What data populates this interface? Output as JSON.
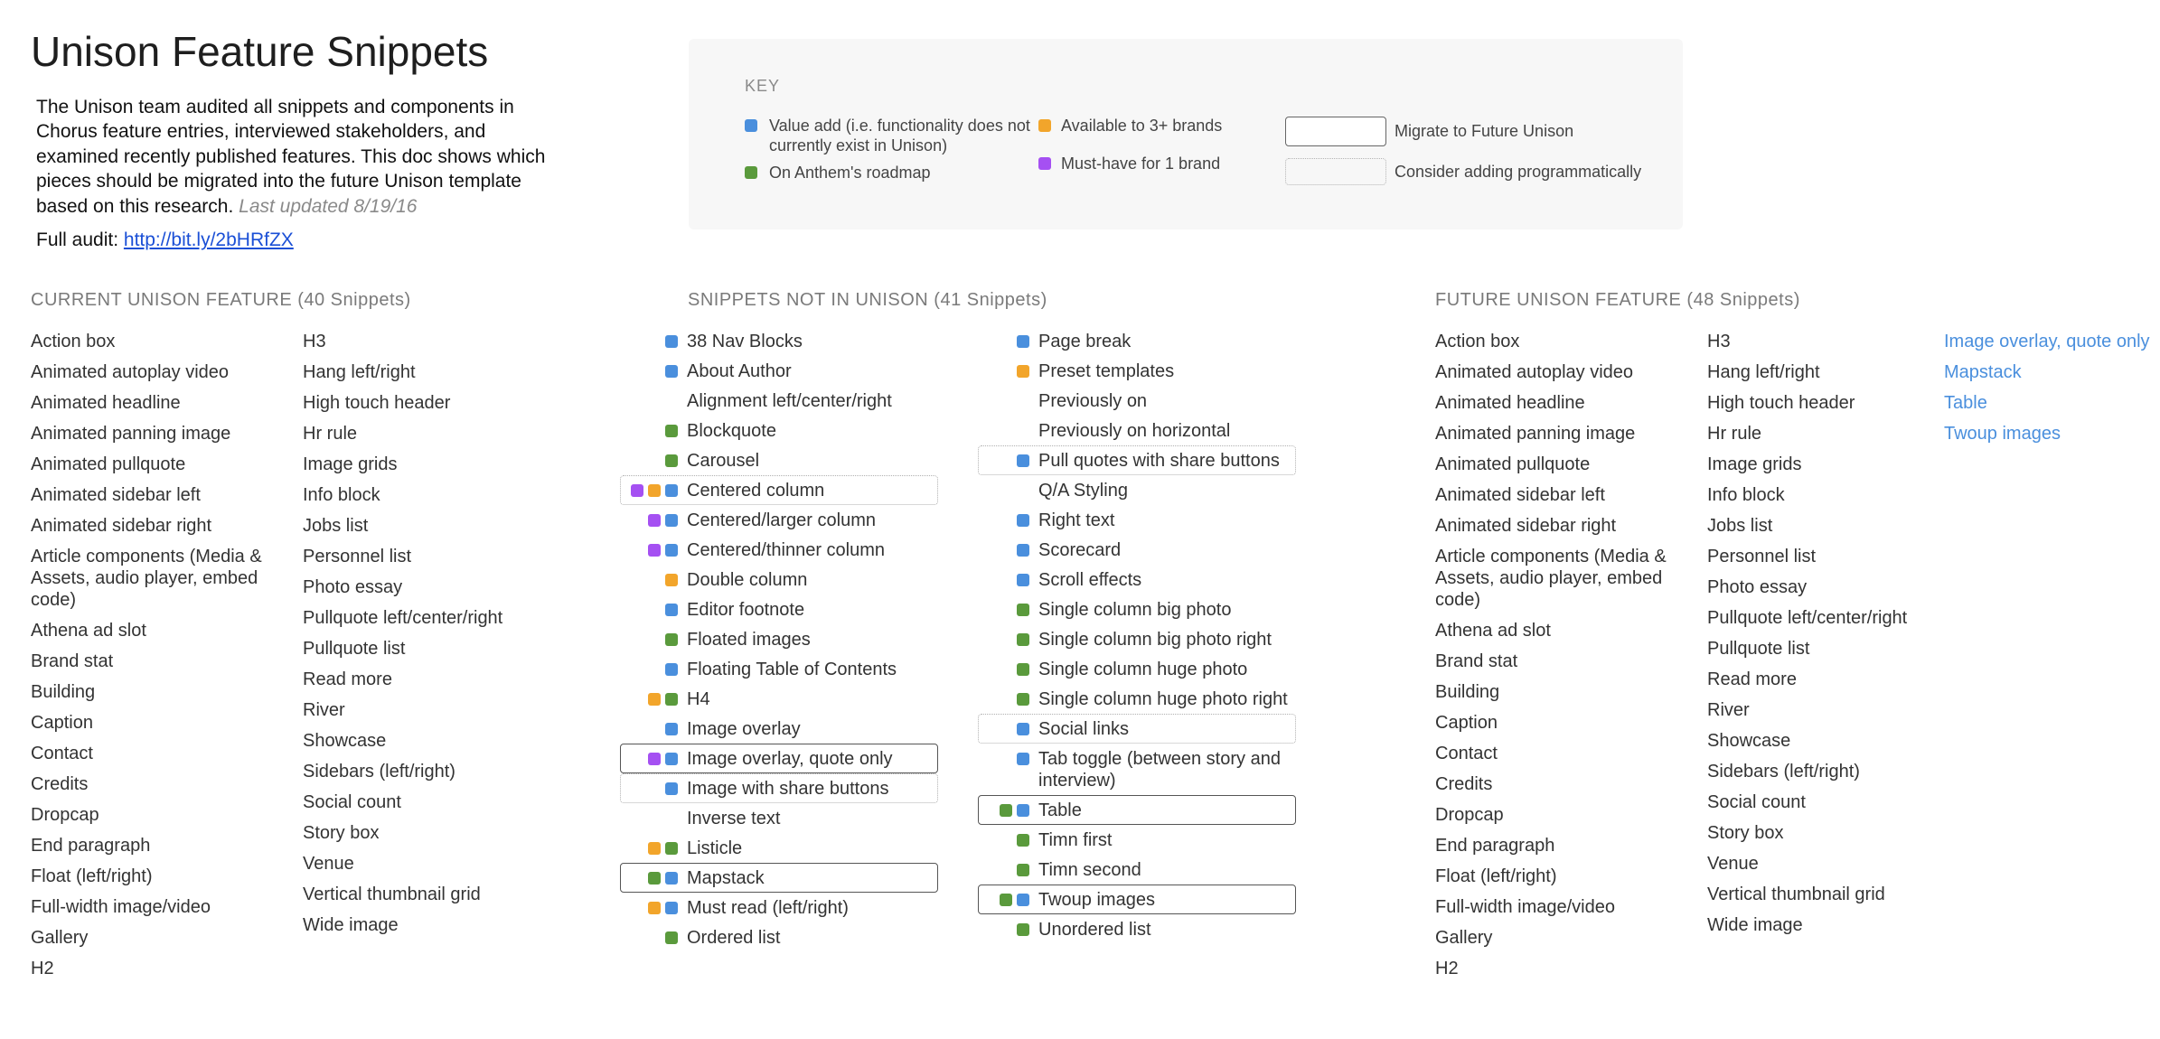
{
  "title": "Unison Feature Snippets",
  "intro": {
    "text": "The Unison team audited all snippets and components in\nChorus feature entries, interviewed stakeholders, and\nexamined recently published features. This doc shows which\npieces should be migrated into the future Unison template\nbased on this research.",
    "updated": "Last updated 8/19/16"
  },
  "audit": {
    "label": "Full audit:",
    "link_text": "http://bit.ly/2bHRfZX"
  },
  "colors": {
    "link": "#1a4fd6",
    "added_item": "#4a8fdd"
  },
  "key": {
    "heading": "KEY",
    "tags": [
      {
        "id": "value-add",
        "color": "#4a8fdd",
        "label": "Value add (i.e. functionality does not currently exist in Unison)"
      },
      {
        "id": "roadmap",
        "color": "#5a9a3c",
        "label": "On Anthem's roadmap"
      },
      {
        "id": "brands",
        "color": "#f2a52b",
        "label": "Available to 3+ brands"
      },
      {
        "id": "must-have",
        "color": "#a550f2",
        "label": "Must-have for 1 brand"
      }
    ],
    "boxes": [
      {
        "id": "migrate",
        "label": "Migrate to Future Unison"
      },
      {
        "id": "consider",
        "label": "Consider adding programmatically"
      }
    ]
  },
  "current": {
    "heading": "CURRENT UNISON FEATURE (40 Snippets)",
    "columns": [
      [
        "Action box",
        "Animated autoplay video",
        "Animated headline",
        "Animated panning image",
        "Animated pullquote",
        "Animated sidebar left",
        "Animated sidebar right",
        "Article components (Media & Assets, audio player, embed code)",
        "Athena ad slot",
        "Brand stat",
        "Building",
        "Caption",
        "Contact",
        "Credits",
        "Dropcap",
        "End paragraph",
        "Float (left/right)",
        "Full-width image/video",
        "Gallery",
        "H2"
      ],
      [
        "H3",
        "Hang left/right",
        "High touch header",
        "Hr rule",
        "Image grids",
        "Info block",
        "Jobs list",
        "Personnel list",
        "Photo essay",
        "Pullquote left/center/right",
        "Pullquote list",
        "Read more",
        "River",
        "Showcase",
        "Sidebars (left/right)",
        "Social count",
        "Story box",
        "Venue",
        "Vertical thumbnail grid",
        "Wide image"
      ]
    ]
  },
  "snippets": {
    "heading": "SNIPPETS NOT IN UNISON (41 Snippets)",
    "columns": [
      [
        {
          "label": "38 Nav Blocks",
          "tags": [
            "value-add"
          ]
        },
        {
          "label": "About Author",
          "tags": [
            "value-add"
          ]
        },
        {
          "label": "Alignment left/center/right",
          "tags": []
        },
        {
          "label": "Blockquote",
          "tags": [
            "roadmap"
          ]
        },
        {
          "label": "Carousel",
          "tags": [
            "roadmap"
          ]
        },
        {
          "label": "Centered column",
          "tags": [
            "must-have",
            "brands",
            "value-add"
          ],
          "box": "consider"
        },
        {
          "label": "Centered/larger column",
          "tags": [
            "must-have",
            "value-add"
          ]
        },
        {
          "label": "Centered/thinner column",
          "tags": [
            "must-have",
            "value-add"
          ]
        },
        {
          "label": "Double column",
          "tags": [
            "brands"
          ]
        },
        {
          "label": "Editor footnote",
          "tags": [
            "value-add"
          ]
        },
        {
          "label": "Floated images",
          "tags": [
            "roadmap"
          ]
        },
        {
          "label": "Floating Table of Contents",
          "tags": [
            "value-add"
          ]
        },
        {
          "label": "H4",
          "tags": [
            "brands",
            "roadmap"
          ]
        },
        {
          "label": "Image overlay",
          "tags": [
            "value-add"
          ]
        },
        {
          "label": "Image overlay, quote only",
          "tags": [
            "must-have",
            "value-add"
          ],
          "box": "migrate"
        },
        {
          "label": "Image with share buttons",
          "tags": [
            "value-add"
          ],
          "box": "consider"
        },
        {
          "label": "Inverse text",
          "tags": []
        },
        {
          "label": "Listicle",
          "tags": [
            "brands",
            "roadmap"
          ]
        },
        {
          "label": "Mapstack",
          "tags": [
            "roadmap",
            "value-add"
          ],
          "box": "migrate"
        },
        {
          "label": "Must read (left/right)",
          "tags": [
            "brands",
            "value-add"
          ]
        },
        {
          "label": "Ordered list",
          "tags": [
            "roadmap"
          ]
        }
      ],
      [
        {
          "label": "Page break",
          "tags": [
            "value-add"
          ]
        },
        {
          "label": "Preset templates",
          "tags": [
            "brands"
          ]
        },
        {
          "label": "Previously on",
          "tags": []
        },
        {
          "label": "Previously on horizontal",
          "tags": []
        },
        {
          "label": "Pull quotes with share buttons",
          "tags": [
            "value-add"
          ],
          "box": "consider"
        },
        {
          "label": "Q/A Styling",
          "tags": []
        },
        {
          "label": "Right text",
          "tags": [
            "value-add"
          ]
        },
        {
          "label": "Scorecard",
          "tags": [
            "value-add"
          ]
        },
        {
          "label": "Scroll effects",
          "tags": [
            "value-add"
          ]
        },
        {
          "label": "Single column big photo",
          "tags": [
            "roadmap"
          ]
        },
        {
          "label": "Single column big photo right",
          "tags": [
            "roadmap"
          ]
        },
        {
          "label": "Single column huge photo",
          "tags": [
            "roadmap"
          ]
        },
        {
          "label": "Single column huge photo right",
          "tags": [
            "roadmap"
          ]
        },
        {
          "label": "Social links",
          "tags": [
            "value-add"
          ],
          "box": "consider"
        },
        {
          "label": "Tab toggle (between story and interview)",
          "tags": [
            "value-add"
          ]
        },
        {
          "label": "Table",
          "tags": [
            "roadmap",
            "value-add"
          ],
          "box": "migrate"
        },
        {
          "label": "Timn first",
          "tags": [
            "roadmap"
          ]
        },
        {
          "label": "Timn second",
          "tags": [
            "roadmap"
          ]
        },
        {
          "label": "Twoup images",
          "tags": [
            "roadmap",
            "value-add"
          ],
          "box": "migrate"
        },
        {
          "label": "Unordered list",
          "tags": [
            "roadmap"
          ]
        }
      ]
    ]
  },
  "future": {
    "heading": "FUTURE UNISON FEATURE (48 Snippets)",
    "columns": [
      [
        "Action box",
        "Animated autoplay video",
        "Animated headline",
        "Animated panning image",
        "Animated pullquote",
        "Animated sidebar left",
        "Animated sidebar right",
        "Article components (Media & Assets, audio player, embed code)",
        "Athena ad slot",
        "Brand stat",
        "Building",
        "Caption",
        "Contact",
        "Credits",
        "Dropcap",
        "End paragraph",
        "Float (left/right)",
        "Full-width image/video",
        "Gallery",
        "H2"
      ],
      [
        "H3",
        "Hang left/right",
        "High touch header",
        "Hr rule",
        "Image grids",
        "Info block",
        "Jobs list",
        "Personnel list",
        "Photo essay",
        "Pullquote left/center/right",
        "Pullquote list",
        "Read more",
        "River",
        "Showcase",
        "Sidebars (left/right)",
        "Social count",
        "Story box",
        "Venue",
        "Vertical thumbnail grid",
        "Wide image"
      ],
      [
        "Image overlay, quote only",
        "Mapstack",
        "Table",
        "Twoup images"
      ]
    ]
  }
}
